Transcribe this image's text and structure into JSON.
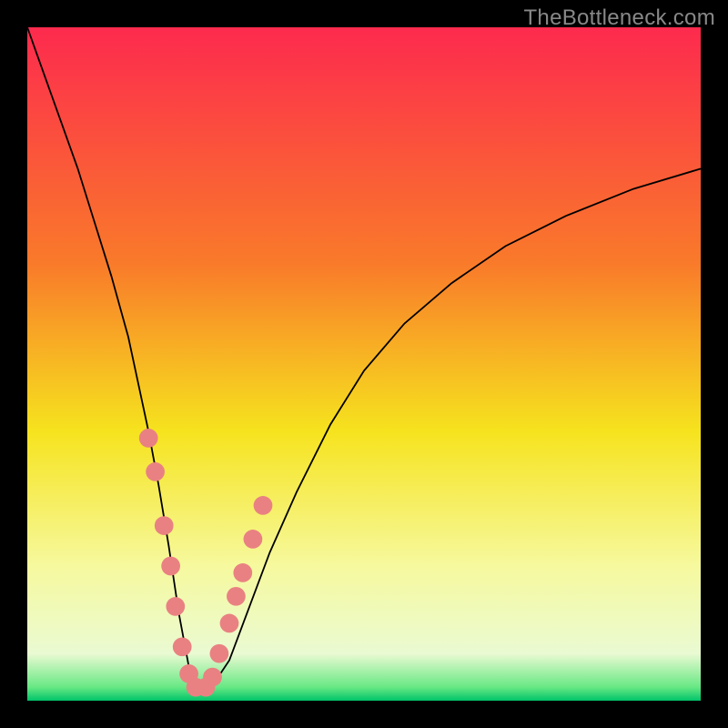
{
  "watermark": "TheBottleneck.com",
  "chart_data": {
    "type": "line",
    "title": "",
    "xlabel": "",
    "ylabel": "",
    "xlim": [
      0,
      100
    ],
    "ylim": [
      0,
      100
    ],
    "legend": false,
    "grid": false,
    "background_gradient": {
      "stops": [
        {
          "pos": 0.0,
          "color": "#fd2a4e"
        },
        {
          "pos": 0.35,
          "color": "#f97a2a"
        },
        {
          "pos": 0.6,
          "color": "#f6e31e"
        },
        {
          "pos": 0.8,
          "color": "#f6f99e"
        },
        {
          "pos": 0.93,
          "color": "#eafad2"
        },
        {
          "pos": 0.98,
          "color": "#67e884"
        },
        {
          "pos": 1.0,
          "color": "#00c36a"
        }
      ]
    },
    "series": [
      {
        "name": "bottleneck-curve",
        "color": "#000000",
        "x": [
          0.0,
          2.5,
          5.0,
          7.5,
          10.0,
          12.5,
          15.0,
          16.5,
          18.0,
          19.5,
          21.0,
          22.5,
          24.0,
          25.5,
          27.0,
          30.0,
          33.0,
          36.0,
          40.0,
          45.0,
          50.0,
          56.0,
          63.0,
          71.0,
          80.0,
          90.0,
          100.0
        ],
        "values": [
          100.0,
          93.0,
          86.0,
          79.0,
          71.0,
          63.0,
          54.0,
          47.0,
          40.0,
          32.0,
          23.0,
          13.0,
          5.0,
          1.5,
          1.5,
          6.0,
          14.0,
          22.0,
          31.0,
          41.0,
          49.0,
          56.0,
          62.0,
          67.5,
          72.0,
          76.0,
          79.0
        ]
      }
    ],
    "points": {
      "name": "sample-markers",
      "color": "#e98182",
      "radius": 1.4,
      "x": [
        18.0,
        19.0,
        20.3,
        21.3,
        22.0,
        23.0,
        24.0,
        25.0,
        26.5,
        27.5,
        28.5,
        30.0,
        31.0,
        32.0,
        33.5,
        35.0
      ],
      "values": [
        39.0,
        34.0,
        26.0,
        20.0,
        14.0,
        8.0,
        4.0,
        2.0,
        2.0,
        3.5,
        7.0,
        11.5,
        15.5,
        19.0,
        24.0,
        29.0
      ]
    }
  }
}
